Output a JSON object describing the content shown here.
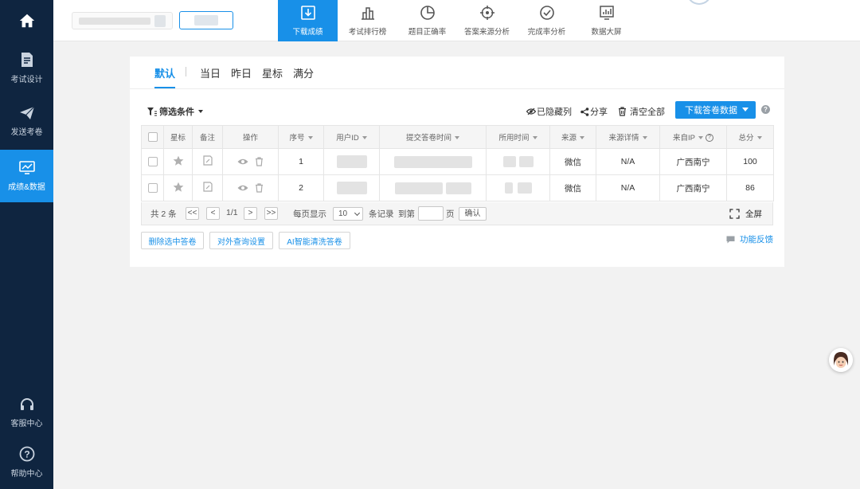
{
  "sidebar": {
    "home_icon": "home-icon",
    "items": [
      {
        "label": "考试设计",
        "icon": "edit-doc-icon"
      },
      {
        "label": "发送考卷",
        "icon": "send-plane-icon"
      },
      {
        "label": "成绩&数据",
        "icon": "chart-monitor-icon",
        "active": true
      },
      {
        "label": "客服中心",
        "icon": "headset-icon"
      },
      {
        "label": "帮助中心",
        "icon": "help-circle-icon"
      }
    ]
  },
  "topnav": {
    "tabs": [
      {
        "label": "下载成绩",
        "icon": "download-icon",
        "active": true
      },
      {
        "label": "考试排行榜",
        "icon": "bar-rank-icon"
      },
      {
        "label": "题目正确率",
        "icon": "pie-icon"
      },
      {
        "label": "答案来源分析",
        "icon": "target-icon"
      },
      {
        "label": "完成率分析",
        "icon": "check-circle-icon"
      },
      {
        "label": "数据大屏",
        "icon": "screen-chart-icon"
      }
    ]
  },
  "filter_tabs": [
    "默认",
    "当日",
    "昨日",
    "星标",
    "满分"
  ],
  "toolbar": {
    "filter_label": "筛选条件",
    "hidden_cols_label": "已隐藏列",
    "share_label": "分享",
    "clear_label": "清空全部",
    "download_label": "下载答卷数据"
  },
  "table": {
    "headers": [
      "星标",
      "备注",
      "操作",
      "序号",
      "用户ID",
      "提交答卷时间",
      "所用时间",
      "来源",
      "来源详情",
      "来自IP",
      "总分"
    ],
    "rows": [
      {
        "seq": "1",
        "source": "微信",
        "source_detail": "N/A",
        "ip": "广西南宁",
        "score": "100"
      },
      {
        "seq": "2",
        "source": "微信",
        "source_detail": "N/A",
        "ip": "广西南宁",
        "score": "86"
      }
    ]
  },
  "pager": {
    "total": "共 2 条",
    "first": "<<",
    "prev": "<",
    "page": "1/1",
    "next": ">",
    "last": ">>",
    "per_page_label": "每页显示",
    "per_page_value": "10",
    "records_label": "条记录",
    "goto_label": "到第",
    "page_unit": "页",
    "confirm": "确认",
    "fullscreen": "全屏"
  },
  "actions": {
    "delete_selected": "删除选中答卷",
    "external_query": "对外查询设置",
    "ai_clean": "AI智能清洗答卷",
    "feedback": "功能反馈"
  },
  "colors": {
    "sidebar_bg": "#0f2540",
    "accent": "#1890e8"
  }
}
